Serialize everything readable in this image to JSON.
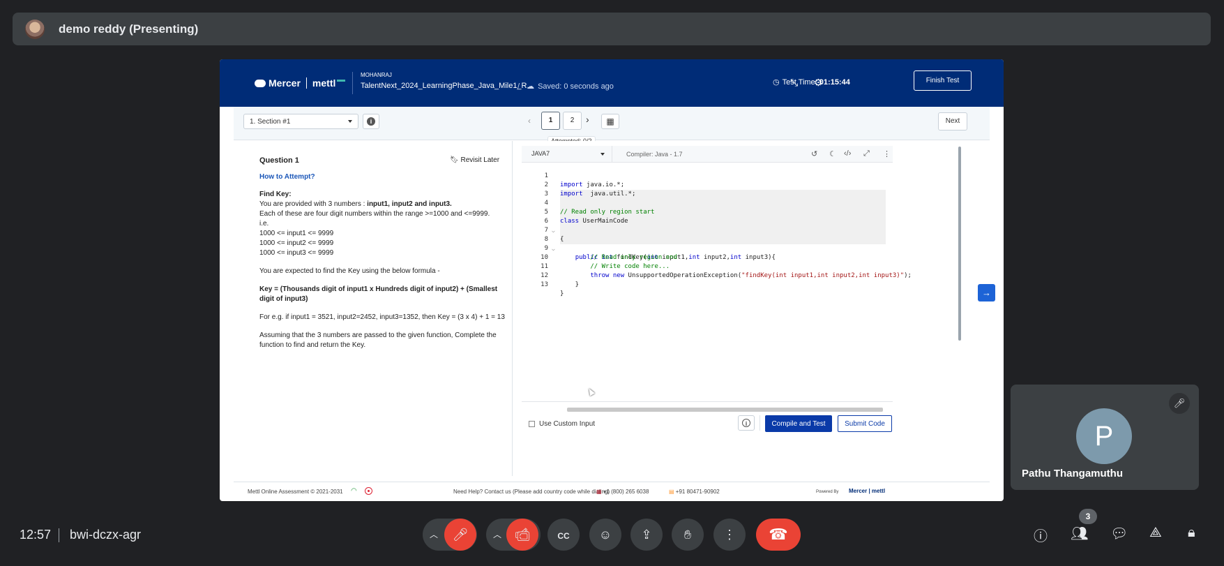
{
  "meet": {
    "presenter": "demo reddy (Presenting)",
    "time": "12:57",
    "meeting_code": "bwi-dczx-agr",
    "participant_count": "3",
    "tile_initial": "P",
    "tile_name": "Pathu Thangamuthu"
  },
  "header": {
    "brand_mercer": "Mercer",
    "brand_mettl": "mettl",
    "owner": "MOHANRAJ",
    "test_name": "TalentNext_2024_LearningPhase_Java_Mile1_R...",
    "slash": "/",
    "saved": "Saved: 0 seconds ago",
    "timer_label": "Test Time:",
    "timer_value": "01:15:44",
    "finish_label": "Finish Test"
  },
  "toolbar": {
    "section": "1. Section #1",
    "pages": [
      "1",
      "2"
    ],
    "attempted": "Attempted: 0/2",
    "next_label": "Next"
  },
  "question": {
    "title": "Question 1",
    "revisit_label": "Revisit Later",
    "how_to": "How to Attempt?",
    "find_key": "Find Key:",
    "intro_a": "You are provided with 3 numbers : ",
    "intro_b": "input1, input2 and input3.",
    "range": "Each of these are four digit numbers within the range >=1000 and <=9999.",
    "ie": "i.e.",
    "c1": "1000 <= input1 <= 9999",
    "c2": "1000 <= input2 <= 9999",
    "c3": "1000 <= input3 <= 9999",
    "expected": "You are expected to find the Key using the below formula -",
    "formula": "Key = (Thousands digit of input1 x Hundreds digit of input2) + (Smallest digit of input3)",
    "example": "For e.g. if input1 = 3521, input2=2452, input3=1352, then Key = (3 x 4) + 1 = 13",
    "assume": "Assuming that the 3 numbers are passed to the given function, Complete the function to find and return the Key."
  },
  "editor": {
    "language": "JAVA7",
    "compiler": "Compiler: Java - 1.7",
    "lines": [
      {
        "n": "1",
        "t": "import java.io.*;"
      },
      {
        "n": "2",
        "t": "import  java.util.*;"
      },
      {
        "n": "3",
        "t": ""
      },
      {
        "n": "4",
        "t": "// Read only region start"
      },
      {
        "n": "5",
        "t": "class UserMainCode"
      },
      {
        "n": "6",
        "t": "{"
      },
      {
        "n": "7",
        "t": ""
      },
      {
        "n": "8",
        "t": "    public int findKey(int input1,int input2,int input3){"
      },
      {
        "n": "9",
        "t": "        // Read only region end"
      },
      {
        "n": "10",
        "t": "        // Write code here..."
      },
      {
        "n": "11",
        "t": "        throw new UnsupportedOperationException(\"findKey(int input1,int input2,int input3)\");"
      },
      {
        "n": "12",
        "t": "    }"
      },
      {
        "n": "13",
        "t": "}"
      }
    ],
    "custom_input_label": "Use Custom Input",
    "compile_label": "Compile and Test",
    "submit_label": "Submit Code"
  },
  "footer": {
    "copyright": "Mettl Online Assessment © 2021-2031",
    "help": "Need Help? Contact us (Please add country code while dialing)",
    "us_phone": "+1 (800) 265 6038",
    "in_phone": "+91 80471-90902",
    "powered": "Powered By",
    "powered_logo": "Mercer | mettl"
  }
}
